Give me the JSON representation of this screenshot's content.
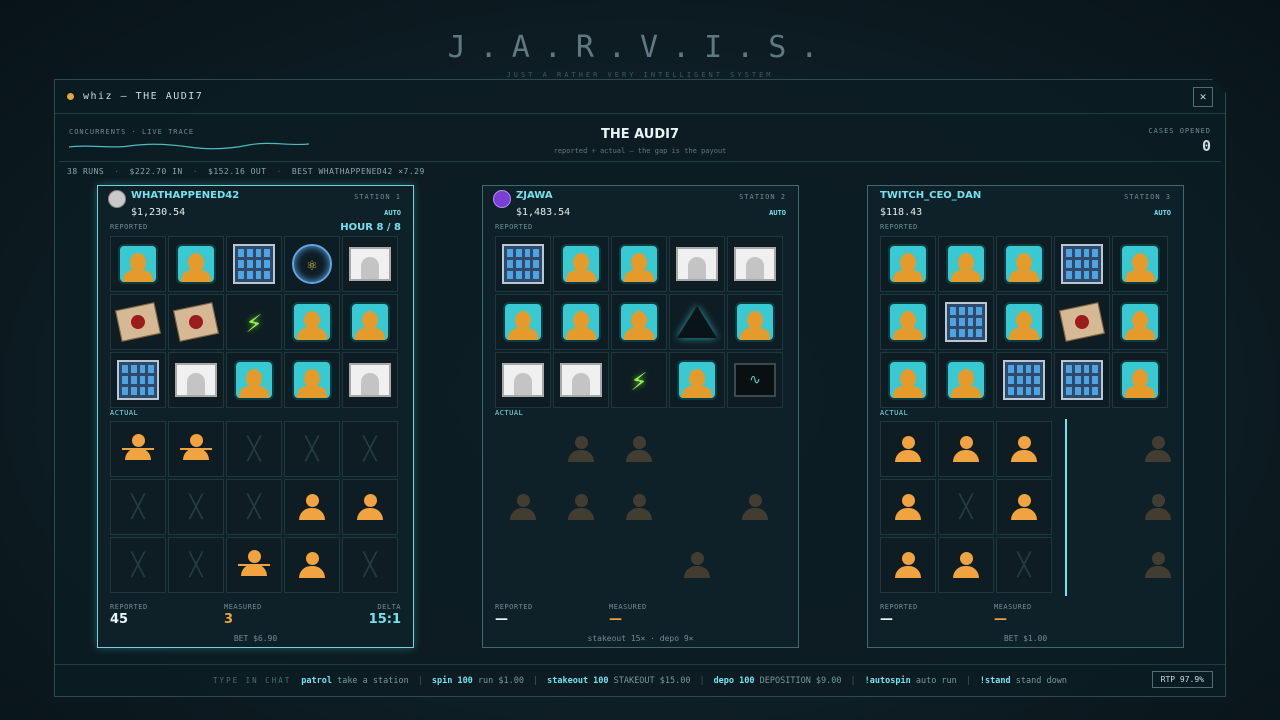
{
  "background": {
    "title": "J.A.R.V.I.S.",
    "subtitle": "JUST A RATHER VERY INTELLIGENT SYSTEM"
  },
  "window": {
    "title": "whiz — THE AUDI7",
    "close_icon": "close-icon"
  },
  "header": {
    "trace_label": "CONCURRENTS · LIVE TRACE",
    "game_title": "THE AUDI7",
    "game_subtitle": "reported ÷ actual — the gap is the payout",
    "cases_label": "CASES OPENED",
    "cases_value": "0"
  },
  "stats": {
    "runs": "38 RUNS",
    "in": "$222.70 IN",
    "out": "$152.16 OUT",
    "best": "BEST WHATHAPPENED42 ×7.29"
  },
  "stations": [
    {
      "name": "WHATHAPPENED42",
      "station": "STATION 1",
      "balance": "$1,230.54",
      "auto": "AUTO",
      "reported_label": "REPORTED",
      "hour": "HOUR 8 / 8",
      "actual_label": "ACTUAL",
      "reported_grid": [
        "bust",
        "bust",
        "servers",
        "atom",
        "id",
        "letter",
        "letter",
        "bolt",
        "bust",
        "bust",
        "servers",
        "id",
        "bust",
        "bust",
        "id"
      ],
      "actual_grid": [
        "person-hat",
        "person-hat",
        "x",
        "x",
        "x",
        "x",
        "x",
        "x",
        "person",
        "person",
        "x",
        "x",
        "person-hat",
        "person",
        "x"
      ],
      "foot": {
        "reported_label": "REPORTED",
        "reported_value": "45",
        "measured_label": "MEASURED",
        "measured_value": "3",
        "delta_label": "DELTA",
        "delta_value": "15:1"
      },
      "bet": "BET $6.90"
    },
    {
      "name": "ZJAWA",
      "station": "STATION 2",
      "balance": "$1,483.54",
      "auto": "AUTO",
      "reported_label": "REPORTED",
      "actual_label": "ACTUAL",
      "reported_grid": [
        "servers",
        "bust",
        "bust",
        "id",
        "id",
        "bust",
        "bust",
        "bust",
        "hacker",
        "bust",
        "id",
        "id",
        "bolt",
        "bust",
        "monitor"
      ],
      "foot": {
        "reported_label": "REPORTED",
        "reported_value": "—",
        "measured_label": "MEASURED",
        "measured_value": "—"
      },
      "bet": "stakeout 15×   ·   depo 9×"
    },
    {
      "name": "TWITCH_CEO_DAN",
      "station": "STATION 3",
      "balance": "$118.43",
      "auto": "AUTO",
      "reported_label": "REPORTED",
      "actual_label": "ACTUAL",
      "reported_grid": [
        "bust",
        "bust",
        "bust",
        "servers",
        "bust",
        "bust",
        "servers",
        "bust",
        "letter",
        "bust",
        "bust",
        "bust",
        "servers",
        "servers",
        "bust"
      ],
      "actual_grid": [
        "person",
        "person",
        "person",
        "person",
        "x",
        "person",
        "person",
        "person",
        "x"
      ],
      "foot": {
        "reported_label": "REPORTED",
        "reported_value": "—",
        "measured_label": "MEASURED",
        "measured_value": "—"
      },
      "bet": "BET $1.00"
    }
  ],
  "bottom": {
    "label": "TYPE IN CHAT",
    "commands": [
      {
        "cmd": "patrol",
        "desc": "take a station"
      },
      {
        "cmd": "spin 100",
        "desc": "run $1.00"
      },
      {
        "cmd": "stakeout 100",
        "desc": "STAKEOUT $15.00"
      },
      {
        "cmd": "depo 100",
        "desc": "DEPOSITION $9.00"
      },
      {
        "cmd": "!autospin",
        "desc": "auto run"
      },
      {
        "cmd": "!stand",
        "desc": "stand down"
      }
    ],
    "rtp": "RTP 97.9%"
  },
  "colors": {
    "accent": "#73e2ee",
    "orange": "#f0a340",
    "bust_bg": "#38c9d2"
  }
}
